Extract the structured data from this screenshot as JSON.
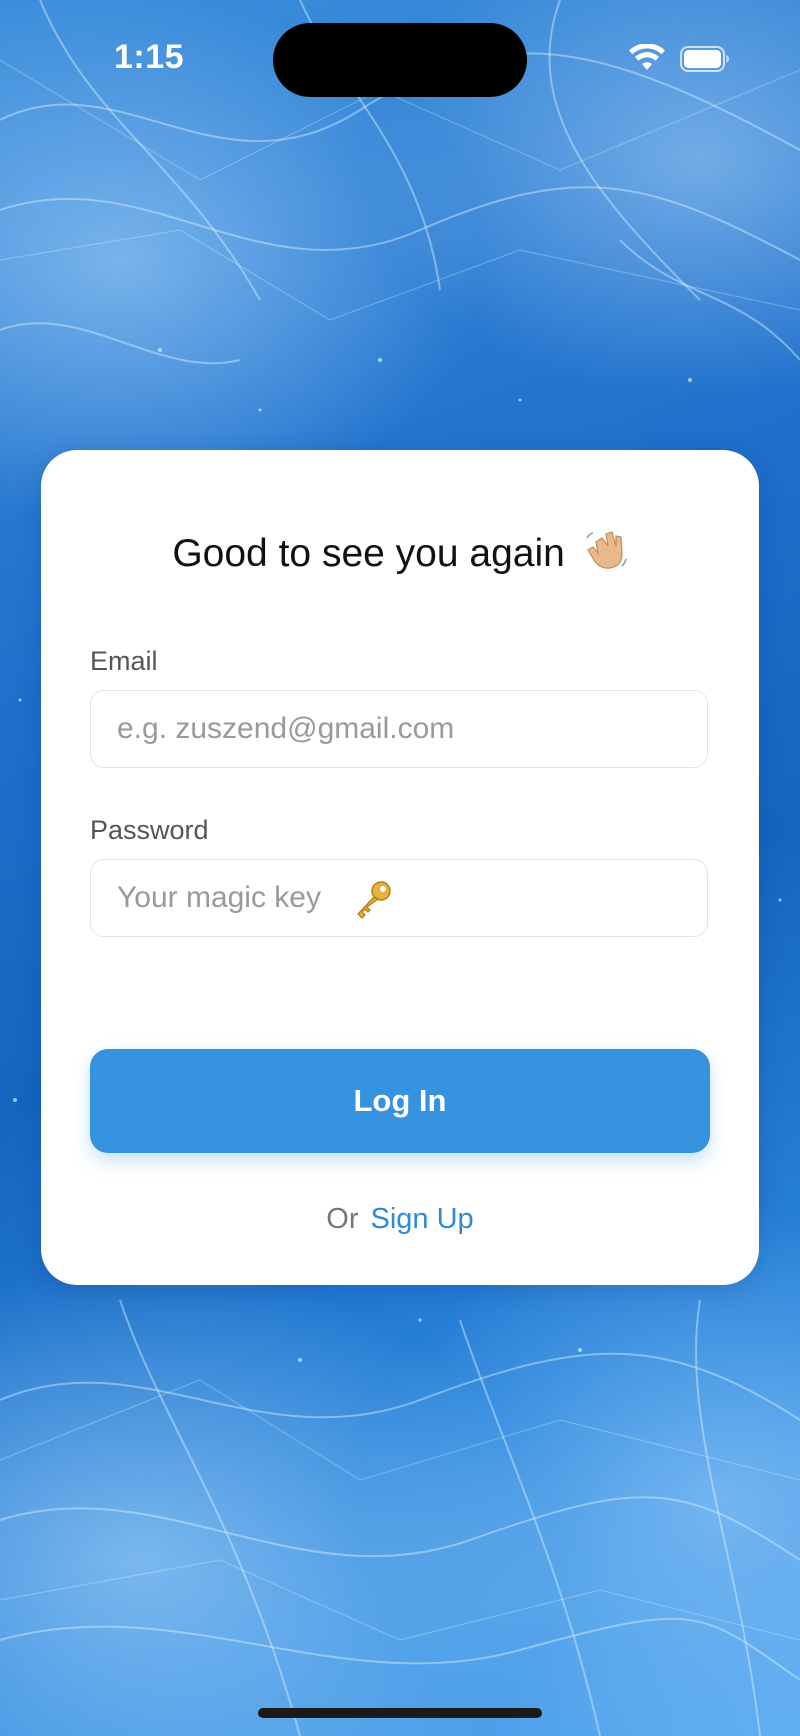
{
  "status_bar": {
    "time": "1:15",
    "icons": [
      "wifi-icon",
      "battery-icon"
    ]
  },
  "login_card": {
    "title": "Good to see you again",
    "title_icon": "waving-hand-icon",
    "email": {
      "label": "Email",
      "placeholder": "e.g. zuszend@gmail.com",
      "value": ""
    },
    "password": {
      "label": "Password",
      "placeholder": "Your magic key",
      "placeholder_icon": "key-icon",
      "value": ""
    },
    "login_button": "Log In",
    "or_text": "Or",
    "signup_link": "Sign Up"
  },
  "colors": {
    "accent": "#3592de",
    "link": "#2f8ad8",
    "background": "#1f6fcc",
    "card": "#ffffff"
  }
}
